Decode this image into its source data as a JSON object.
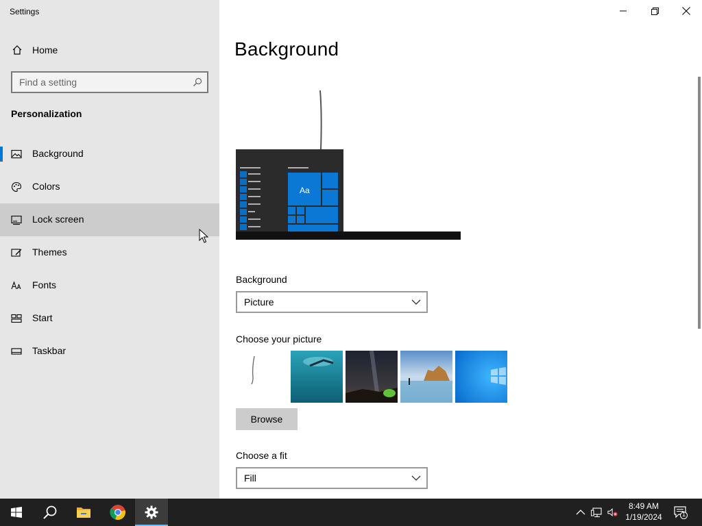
{
  "window": {
    "title": "Settings",
    "minimize_icon": "minimize-icon",
    "maximize_icon": "restore-icon",
    "close_icon": "close-icon"
  },
  "nav": {
    "home_label": "Home",
    "search_placeholder": "Find a setting",
    "section_title": "Personalization",
    "selected": "Background",
    "hovered": "Lock screen",
    "items": [
      {
        "label": "Background",
        "icon": "picture-icon"
      },
      {
        "label": "Colors",
        "icon": "palette-icon"
      },
      {
        "label": "Lock screen",
        "icon": "lock-screen-icon"
      },
      {
        "label": "Themes",
        "icon": "themes-icon"
      },
      {
        "label": "Fonts",
        "icon": "fonts-icon"
      },
      {
        "label": "Start",
        "icon": "start-icon"
      },
      {
        "label": "Taskbar",
        "icon": "taskbar-icon"
      }
    ]
  },
  "content": {
    "page_title": "Background",
    "preview_tile_text": "Aa",
    "background_label": "Background",
    "background_value": "Picture",
    "choose_picture_label": "Choose your picture",
    "browse_label": "Browse",
    "choose_fit_label": "Choose a fit",
    "fit_value": "Fill"
  },
  "taskbar": {
    "time": "8:49 AM",
    "date": "1/19/2024",
    "notification_count": "1",
    "apps": [
      "start-icon",
      "search-icon",
      "file-explorer-icon",
      "chrome-icon",
      "settings-icon"
    ]
  },
  "colors": {
    "accent": "#0078d7",
    "nav_bg": "#e6e6e6",
    "taskbar_bg": "#202020"
  }
}
